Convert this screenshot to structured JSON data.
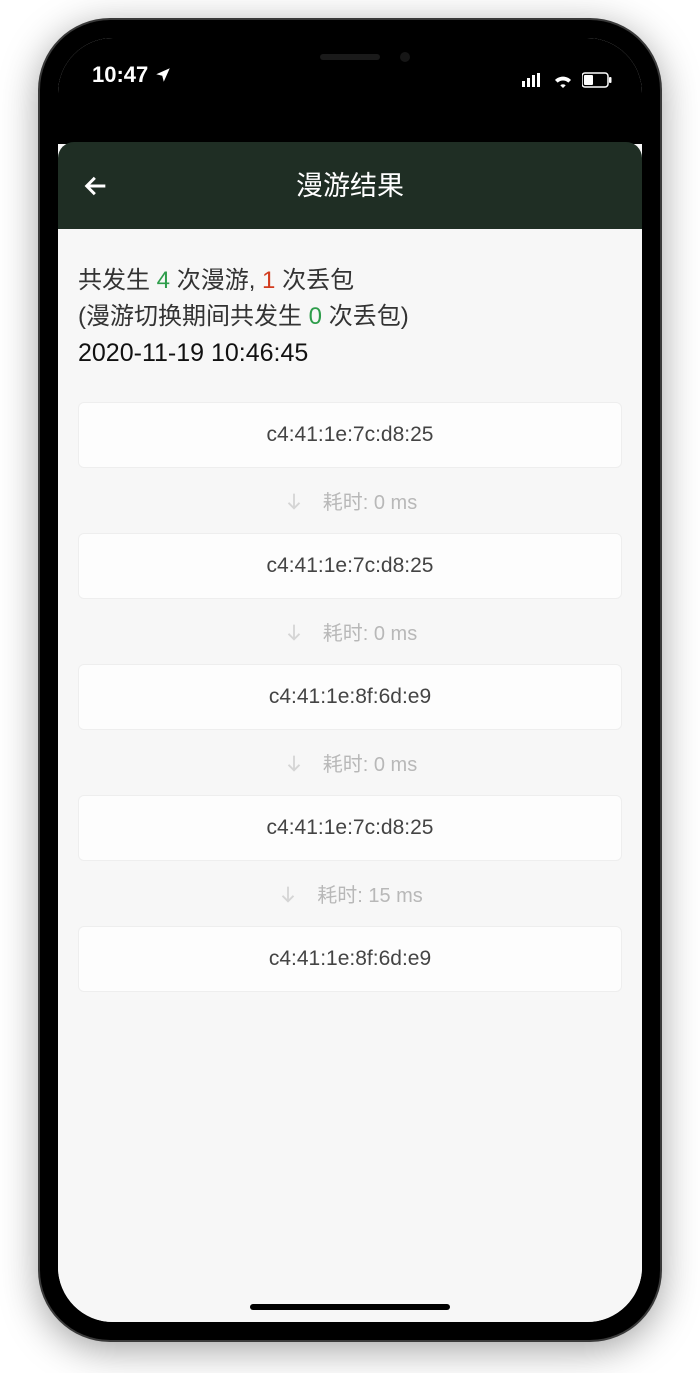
{
  "status": {
    "time": "10:47",
    "location_icon": "location-arrow"
  },
  "header": {
    "title": "漫游结果",
    "back_icon": "arrow-left"
  },
  "summary": {
    "prefix1": "共发生 ",
    "roam_count": "4",
    "mid1": " 次漫游, ",
    "loss_count": "1",
    "suffix1": " 次丢包",
    "line2_prefix": "(漫游切换期间共发生 ",
    "switch_loss": "0",
    "line2_suffix": " 次丢包)",
    "timestamp": "2020-11-19 10:46:45"
  },
  "duration_label_prefix": "耗时: ",
  "duration_label_suffix": " ms",
  "hops": [
    {
      "mac": "c4:41:1e:7c:d8:25",
      "duration": "0"
    },
    {
      "mac": "c4:41:1e:7c:d8:25",
      "duration": "0"
    },
    {
      "mac": "c4:41:1e:8f:6d:e9",
      "duration": "0"
    },
    {
      "mac": "c4:41:1e:7c:d8:25",
      "duration": "15"
    },
    {
      "mac": "c4:41:1e:8f:6d:e9"
    }
  ]
}
